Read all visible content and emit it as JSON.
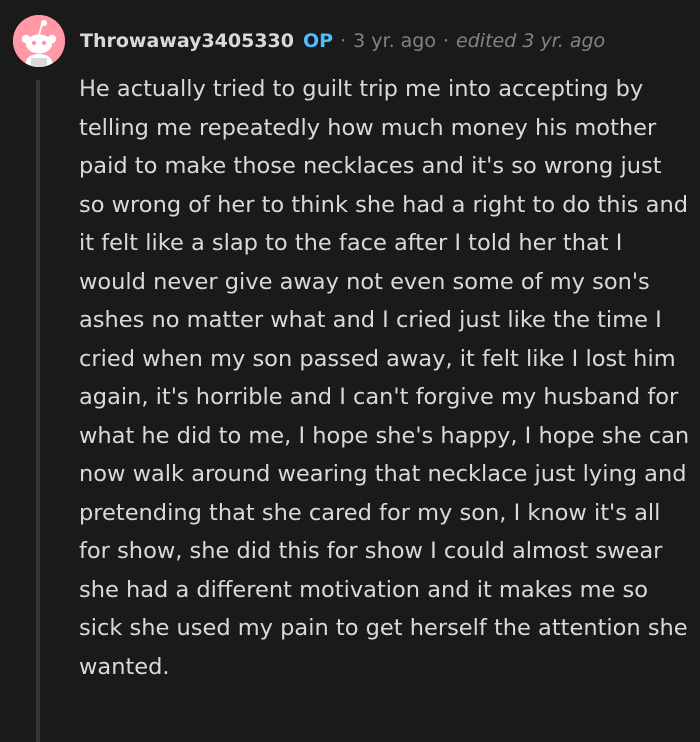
{
  "comment": {
    "username": "Throwaway3405330",
    "op_badge": "OP",
    "separator": "·",
    "timestamp": "3 yr. ago",
    "edited": "edited 3 yr. ago",
    "avatar_icon": "snoo-avatar-icon",
    "body": "He actually tried to guilt trip me into accepting by telling me repeatedly how much money his mother paid to make those necklaces and it's so wrong just so wrong of her to think she had a right to do this and it felt like a slap to the face after I told her that I would never give away not even some of my son's ashes no matter what and I cried just like the time I cried when my son passed away, it felt like I lost him again, it's horrible and I can't forgive my husband for what he did to me, I hope she's happy, I hope she can now walk around wearing that necklace just lying and pretending that she cared for my son, I know it's all for show, she did this for show I could almost swear she had a different motivation and it makes me so sick she used my pain to get herself the attention she wanted."
  },
  "colors": {
    "background": "#1a1a1b",
    "text": "#d7dadc",
    "muted": "#818384",
    "op": "#4fbcff",
    "avatar_bg": "#ff99a8",
    "thread_line": "#343536"
  }
}
